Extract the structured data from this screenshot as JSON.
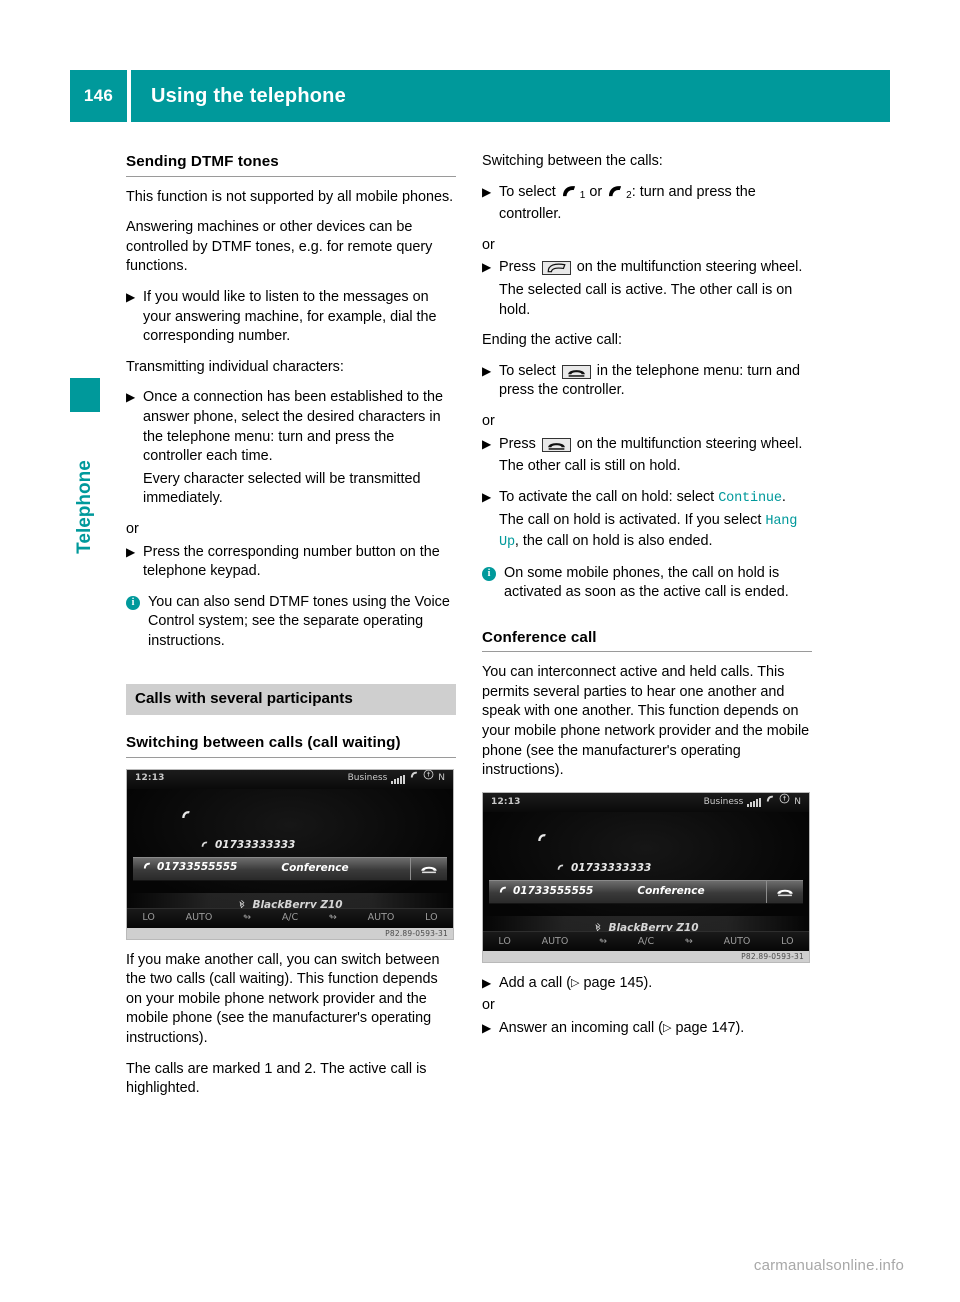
{
  "header": {
    "page_number": "146",
    "title": "Using the telephone",
    "accent_color": "#00999b"
  },
  "side_tab": {
    "label": "Telephone"
  },
  "left_column": {
    "heading": "Sending DTMF tones",
    "p1": "This function is not supported by all mobile phones.",
    "p2": "Answering machines or other devices can be controlled by DTMF tones, e.g. for remote query functions.",
    "step1": "If you would like to listen to the messages on your answering machine, for example, dial the corresponding number.",
    "p3": "Transmitting individual characters:",
    "step2": "Once a connection has been established to the answer phone, select the desired characters in the telephone menu: turn and press the controller each time.",
    "step2_note": "Every character selected will be transmitted immediately.",
    "or1": "or",
    "step3": "Press the corresponding number button on the telephone keypad.",
    "note1": "You can also send DTMF tones using the Voice Control system; see the separate operating instructions.",
    "band": "Calls with several participants",
    "sub_heading": "Switching between calls (call waiting)",
    "p4": "If you make another call, you can switch between the two calls (call waiting). This function depends on your mobile phone network provider and the mobile phone (see the manufacturer's operating instructions).",
    "p5": "The calls are marked 1 and 2. The active call is highlighted."
  },
  "right_column": {
    "p1": "Switching between the calls:",
    "step1_a": "To select",
    "step1_or": "or",
    "step1_b": ": turn and press the controller.",
    "or1": "or",
    "step2_a": "Press",
    "step2_b": "on the multifunction steering wheel.",
    "step2_note": "The selected call is active. The other call is on hold.",
    "p2": "Ending the active call:",
    "step3_a": "To select",
    "step3_b": "in the telephone menu: turn and press the controller.",
    "or2": "or",
    "step4_a": "Press",
    "step4_b": "on the multifunction steering wheel.",
    "step4_note": "The other call is still on hold.",
    "step5_a": "To activate the call on hold: select",
    "step5_menu": "Continue",
    "step5_period": ".",
    "step5_note_a": "The call on hold is activated. If you select",
    "step5_note_menu": "Hang Up",
    "step5_note_b": ", the call on hold is also ended.",
    "note1": "On some mobile phones, the call on hold is activated as soon as the active call is ended.",
    "heading2": "Conference call",
    "p3": "You can interconnect active and held calls. This permits several parties to hear one another and speak with one another. This function depends on your mobile phone network provider and the mobile phone (see the manufacturer's operating instructions).",
    "step6": "Add a call (",
    "step6_ref": "page 145",
    "step6_end": ").",
    "or3": "or",
    "step7": "Answer an incoming call (",
    "step7_ref": "page 147",
    "step7_end": ")."
  },
  "comand_screenshot": {
    "time": "12:13",
    "network": "Business",
    "roaming": "N",
    "call_1_number": "01733333333",
    "call_2_number": "01733555555",
    "conference_label": "Conference",
    "device_name": "BlackBerry Z10",
    "climate": [
      "LO",
      "AUTO",
      "A/C",
      "AUTO",
      "LO"
    ],
    "figure_id": "P82.89-0593-31"
  },
  "footer": {
    "watermark": "carmanualsonline.info"
  },
  "icons": {
    "bullet_marker": "▶",
    "page_ref_arrow": "▷"
  }
}
